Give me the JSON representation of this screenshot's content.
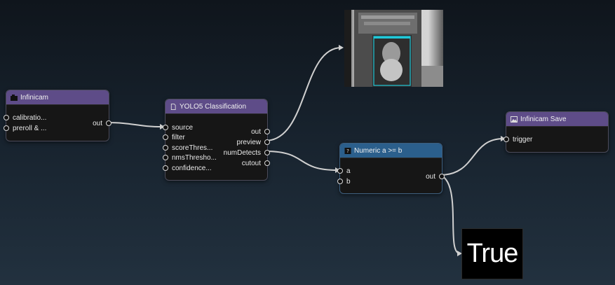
{
  "nodes": {
    "infinicam": {
      "title": "Infinicam",
      "inputs": [
        "calibratio...",
        "preroll & ..."
      ],
      "outputs": [
        "out"
      ]
    },
    "yolo": {
      "title": "YOLO5 Classification",
      "inputs": [
        "source",
        "filter",
        "scoreThres...",
        "nmsThresho...",
        "confidence..."
      ],
      "outputs": [
        "out",
        "preview",
        "numDetects",
        "cutout"
      ]
    },
    "numeric": {
      "title": "Numeric a >= b",
      "inputs": [
        "a",
        "b"
      ],
      "outputs": [
        "out"
      ]
    },
    "save": {
      "title": "Infinicam Save",
      "inputs": [
        "trigger"
      ]
    }
  },
  "result_display": {
    "value": "True"
  },
  "colors": {
    "header_purple": "#5e4c88",
    "header_blue": "#2b5f8c",
    "wire": "#d0d0d0",
    "detection_box": "#20c8d8"
  },
  "icons": {
    "infinicam": "camera-icon",
    "yolo": "document-icon",
    "numeric": "question-icon",
    "save": "image-icon"
  }
}
